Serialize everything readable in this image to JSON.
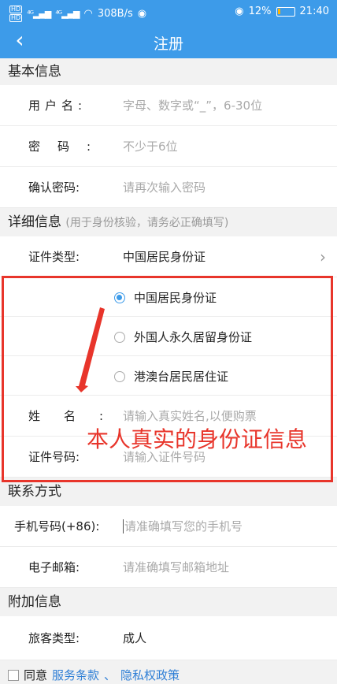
{
  "status": {
    "speed": "308B/s",
    "battery": "12%",
    "time": "21:40"
  },
  "nav": {
    "back": "‹",
    "title": "注册"
  },
  "sections": {
    "basic": "基本信息",
    "detail": "详细信息",
    "detail_hint": "(用于身份核验，请务必正确填写)",
    "contact": "联系方式",
    "extra": "附加信息"
  },
  "fields": {
    "username": {
      "label": "用户名:",
      "placeholder": "字母、数字或“_”，6-30位"
    },
    "password": {
      "label": "密码:",
      "placeholder": "不少于6位"
    },
    "confirm": {
      "label": "确认密码:",
      "placeholder": "请再次输入密码"
    },
    "id_type": {
      "label": "证件类型:",
      "value": "中国居民身份证"
    },
    "name": {
      "label": "姓名:",
      "placeholder": "请输入真实姓名,以便购票"
    },
    "id_number": {
      "label": "证件号码:",
      "placeholder": "请输入证件号码"
    },
    "phone": {
      "label": "手机号码(+86):",
      "placeholder": "请准确填写您的手机号"
    },
    "email": {
      "label": "电子邮箱:",
      "placeholder": "请准确填写邮箱地址"
    },
    "passenger": {
      "label": "旅客类型:",
      "value": "成人"
    }
  },
  "id_options": [
    {
      "label": "中国居民身份证",
      "selected": true
    },
    {
      "label": "外国人永久居留身份证",
      "selected": false
    },
    {
      "label": "港澳台居民居住证",
      "selected": false
    }
  ],
  "annotation": "本人真实的身份证信息",
  "agree": {
    "prefix": "同意",
    "terms": "服务条款",
    "sep": "、",
    "privacy": "隐私权政策"
  },
  "colors": {
    "accent": "#3d9be9",
    "annotation": "#e8352b",
    "link": "#2f7fd6"
  }
}
